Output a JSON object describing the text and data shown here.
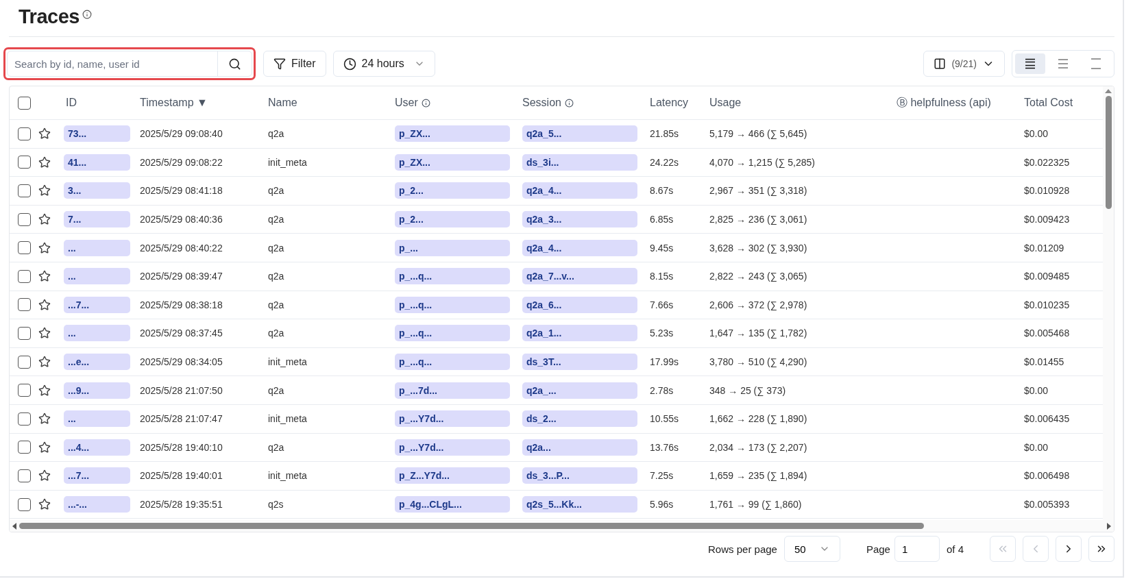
{
  "title": "Traces",
  "title_info": true,
  "search": {
    "placeholder": "Search by id, name, user id",
    "highlighted": true
  },
  "filter_button": "Filter",
  "time_range": "24 hours",
  "columns_button": "(9/21)",
  "density": [
    {
      "kind": "comfortable",
      "selected": true
    },
    {
      "kind": "normal",
      "selected": false
    },
    {
      "kind": "compact",
      "selected": false
    }
  ],
  "table": {
    "select_all_checked": false,
    "columns": [
      {
        "label": "ID",
        "info": false
      },
      {
        "label": "Timestamp ▼",
        "info": false
      },
      {
        "label": "Name",
        "info": false
      },
      {
        "label": "User",
        "info": true
      },
      {
        "label": "Session",
        "info": true
      },
      {
        "label": "Latency",
        "info": false
      },
      {
        "label": "Usage",
        "info": false
      },
      {
        "label": "helpfulness (api)",
        "info": false,
        "prefix": "Ⓑ"
      },
      {
        "label": "Total Cost",
        "info": false
      }
    ],
    "rows": [
      {
        "checked": false,
        "starred": false,
        "id": "73...",
        "timestamp": "2025/5/29 09:08:40",
        "name": "q2a",
        "user": "p_ZX...",
        "session": "q2a_5...",
        "latency": "21.85s",
        "usage": "5,179 → 466 (∑ 5,645)",
        "cost": "$0.00"
      },
      {
        "checked": false,
        "starred": false,
        "id": "41...",
        "timestamp": "2025/5/29 09:08:22",
        "name": "init_meta",
        "user": "p_ZX...",
        "session": "ds_3i...",
        "latency": "24.22s",
        "usage": "4,070 → 1,215 (∑ 5,285)",
        "cost": "$0.022325"
      },
      {
        "checked": false,
        "starred": false,
        "id": "3...",
        "timestamp": "2025/5/29 08:41:18",
        "name": "q2a",
        "user": "p_2...",
        "session": "q2a_4...",
        "latency": "8.67s",
        "usage": "2,967 → 351 (∑ 3,318)",
        "cost": "$0.010928"
      },
      {
        "checked": false,
        "starred": false,
        "id": "7...",
        "timestamp": "2025/5/29 08:40:36",
        "name": "q2a",
        "user": "p_2...",
        "session": "q2a_3...",
        "latency": "6.85s",
        "usage": "2,825 → 236 (∑ 3,061)",
        "cost": "$0.009423"
      },
      {
        "checked": false,
        "starred": false,
        "id": "...",
        "timestamp": "2025/5/29 08:40:22",
        "name": "q2a",
        "user": "p_...",
        "session": "q2a_4...",
        "latency": "9.45s",
        "usage": "3,628 → 302 (∑ 3,930)",
        "cost": "$0.01209"
      },
      {
        "checked": false,
        "starred": false,
        "id": "...",
        "timestamp": "2025/5/29 08:39:47",
        "name": "q2a",
        "user": "p_...q...",
        "session": "q2a_7...v...",
        "latency": "8.15s",
        "usage": "2,822 → 243 (∑ 3,065)",
        "cost": "$0.009485"
      },
      {
        "checked": false,
        "starred": false,
        "id": "...7...",
        "timestamp": "2025/5/29 08:38:18",
        "name": "q2a",
        "user": "p_...q...",
        "session": "q2a_6...",
        "latency": "7.66s",
        "usage": "2,606 → 372 (∑ 2,978)",
        "cost": "$0.010235"
      },
      {
        "checked": false,
        "starred": false,
        "id": "...",
        "timestamp": "2025/5/29 08:37:45",
        "name": "q2a",
        "user": "p_...q...",
        "session": "q2a_1...",
        "latency": "5.23s",
        "usage": "1,647 → 135 (∑ 1,782)",
        "cost": "$0.005468"
      },
      {
        "checked": false,
        "starred": false,
        "id": "...e...",
        "timestamp": "2025/5/29 08:34:05",
        "name": "init_meta",
        "user": "p_...q...",
        "session": "ds_3T...",
        "latency": "17.99s",
        "usage": "3,780 → 510 (∑ 4,290)",
        "cost": "$0.01455"
      },
      {
        "checked": false,
        "starred": false,
        "id": "...9...",
        "timestamp": "2025/5/28 21:07:50",
        "name": "q2a",
        "user": "p_...7d...",
        "session": "q2a_...",
        "latency": "2.78s",
        "usage": "348 → 25 (∑ 373)",
        "cost": "$0.00"
      },
      {
        "checked": false,
        "starred": false,
        "id": "...",
        "timestamp": "2025/5/28 21:07:47",
        "name": "init_meta",
        "user": "p_...Y7d...",
        "session": "ds_2...",
        "latency": "10.55s",
        "usage": "1,662 → 228 (∑ 1,890)",
        "cost": "$0.006435"
      },
      {
        "checked": false,
        "starred": false,
        "id": "...4...",
        "timestamp": "2025/5/28 19:40:10",
        "name": "q2a",
        "user": "p_...Y7d...",
        "session": "q2a...",
        "latency": "13.76s",
        "usage": "2,034 → 173 (∑ 2,207)",
        "cost": "$0.00"
      },
      {
        "checked": false,
        "starred": false,
        "id": "...7...",
        "timestamp": "2025/5/28 19:40:01",
        "name": "init_meta",
        "user": "p_Z...Y7d...",
        "session": "ds_3...P...",
        "latency": "7.25s",
        "usage": "1,659 → 235 (∑ 1,894)",
        "cost": "$0.006498"
      },
      {
        "checked": false,
        "starred": false,
        "id": "...-...",
        "timestamp": "2025/5/28 19:35:51",
        "name": "q2s",
        "user": "p_4g...CLgL...",
        "session": "q2s_5...Kk...",
        "latency": "5.96s",
        "usage": "1,761 → 99 (∑ 1,860)",
        "cost": "$0.005393"
      }
    ]
  },
  "pagination": {
    "rows_label": "Rows per page",
    "rows_value": "50",
    "page_label": "Page",
    "page_value": "1",
    "of_label": "of 4"
  }
}
